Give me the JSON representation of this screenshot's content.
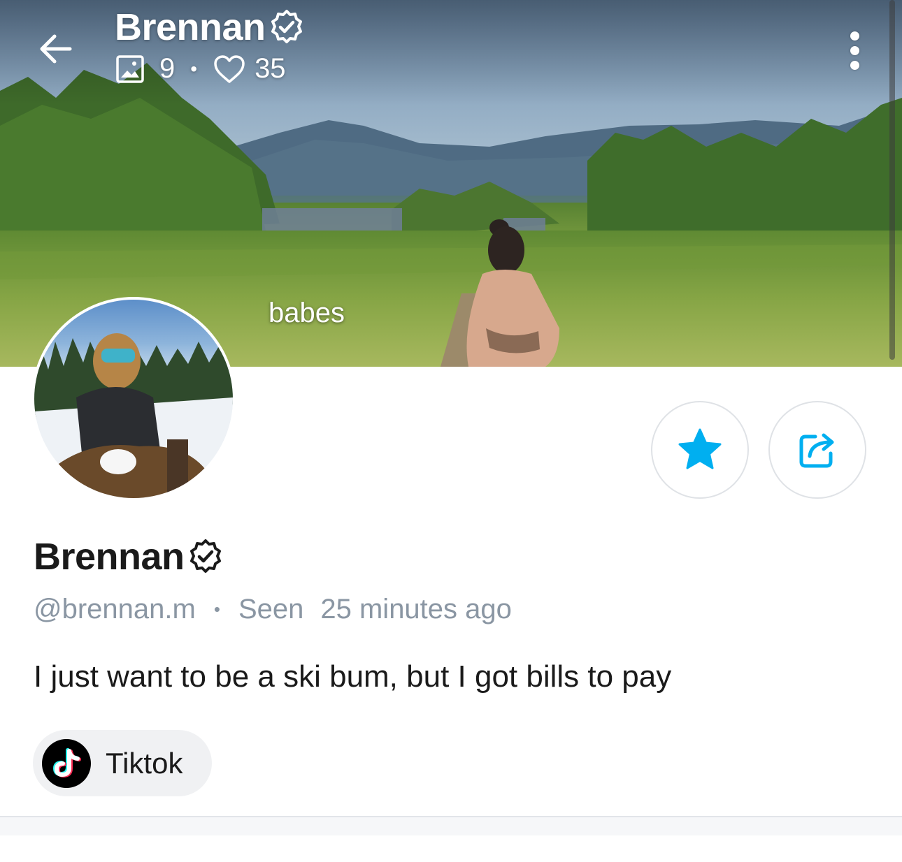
{
  "header": {
    "name": "Brennan",
    "media_count": "9",
    "likes_count": "35",
    "stat_separator": "•"
  },
  "cover": {
    "caption": "babes"
  },
  "profile": {
    "name": "Brennan",
    "handle": "@brennan.m",
    "meta_separator": "•",
    "seen_label": "Seen",
    "seen_time": "25 minutes ago",
    "bio": "I just want to be a ski bum, but I got bills to pay"
  },
  "links": [
    {
      "label": "Tiktok",
      "icon": "tiktok-icon"
    }
  ],
  "colors": {
    "accent": "#00aff0",
    "muted_text": "#8a96a3",
    "chip_bg": "#f0f1f3",
    "border": "#dfe2e6"
  },
  "icons": {
    "back": "arrow-left-icon",
    "media": "image-icon",
    "likes": "heart-icon",
    "verified": "verified-badge-icon",
    "menu": "more-vertical-icon",
    "favorite": "star-icon",
    "share": "share-icon"
  }
}
